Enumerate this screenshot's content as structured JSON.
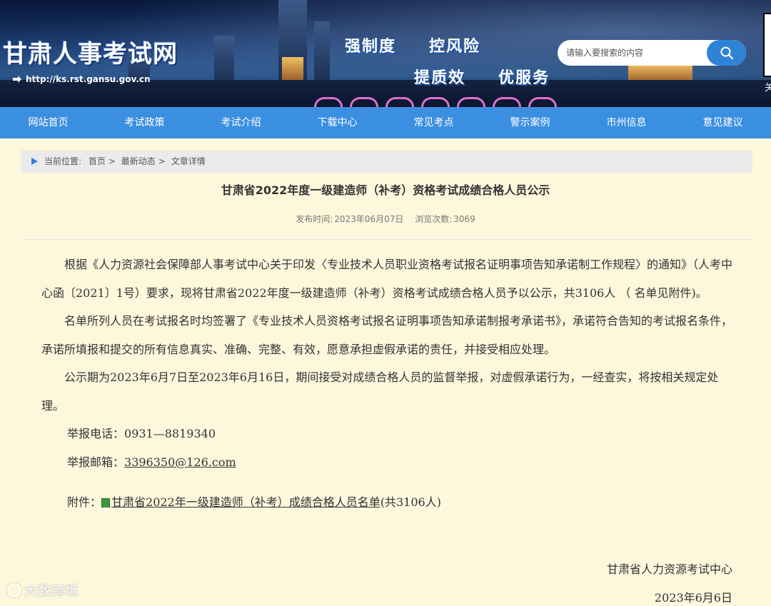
{
  "header": {
    "site_title": "甘肃人事考试网",
    "site_url": "http://ks.rst.gansu.gov.cn",
    "slogans": [
      "强制度",
      "控风险",
      "提质效",
      "优服务"
    ],
    "search_placeholder": "请输入要搜索的内容",
    "qr_label": "关"
  },
  "nav": {
    "items": [
      "网站首页",
      "考试政策",
      "考试介绍",
      "下载中心",
      "常见考点",
      "警示案例",
      "市州信息",
      "意见建议"
    ]
  },
  "breadcrumb": {
    "label": "当前位置:",
    "items": [
      "首页",
      "最新动态",
      "文章详情"
    ],
    "separator": ">"
  },
  "article": {
    "title": "甘肃省2022年度一级建造师（补考）资格考试成绩合格人员公示",
    "publish_label": "发布时间:",
    "publish_date": "2023年06月07日",
    "views_label": "浏览次数:",
    "views": "3069",
    "paragraph1": "根据《人力资源社会保障部人事考试中心关于印发〈专业技术人员职业资格考试报名证明事项告知承诺制工作规程〉的通知》（人考中心函〔2021〕1号）要求，现将甘肃省2022年度一级建造师（补考）资格考试成绩合格人员予以公示，共3106人 （ 名单见附件)。",
    "paragraph2": "名单所列人员在考试报名时均签署了《专业技术人员资格考试报名证明事项告知承诺制报考承诺书》，承诺符合告知的考试报名条件，承诺所填报和提交的所有信息真实、准确、完整、有效，愿意承担虚假承诺的责任，并接受相应处理。",
    "paragraph3": "公示期为2023年6月7日至2023年6月16日，期间接受对成绩合格人员的监督举报，对虚假承诺行为，一经查实，将按相关规定处理。",
    "phone_label": "举报电话：",
    "phone": "0931—8819340",
    "email_label": "举报邮箱：",
    "email": "3396350@126.com",
    "attachment_label": "附件：",
    "attachment_link": "甘肃省2022年一级建造师（补考）成绩合格人员名单",
    "attachment_suffix": "(共3106人)",
    "issuer": "甘肃省人力资源考试中心",
    "issue_date": "2023年6月6日"
  },
  "watermark": "大数跨境"
}
